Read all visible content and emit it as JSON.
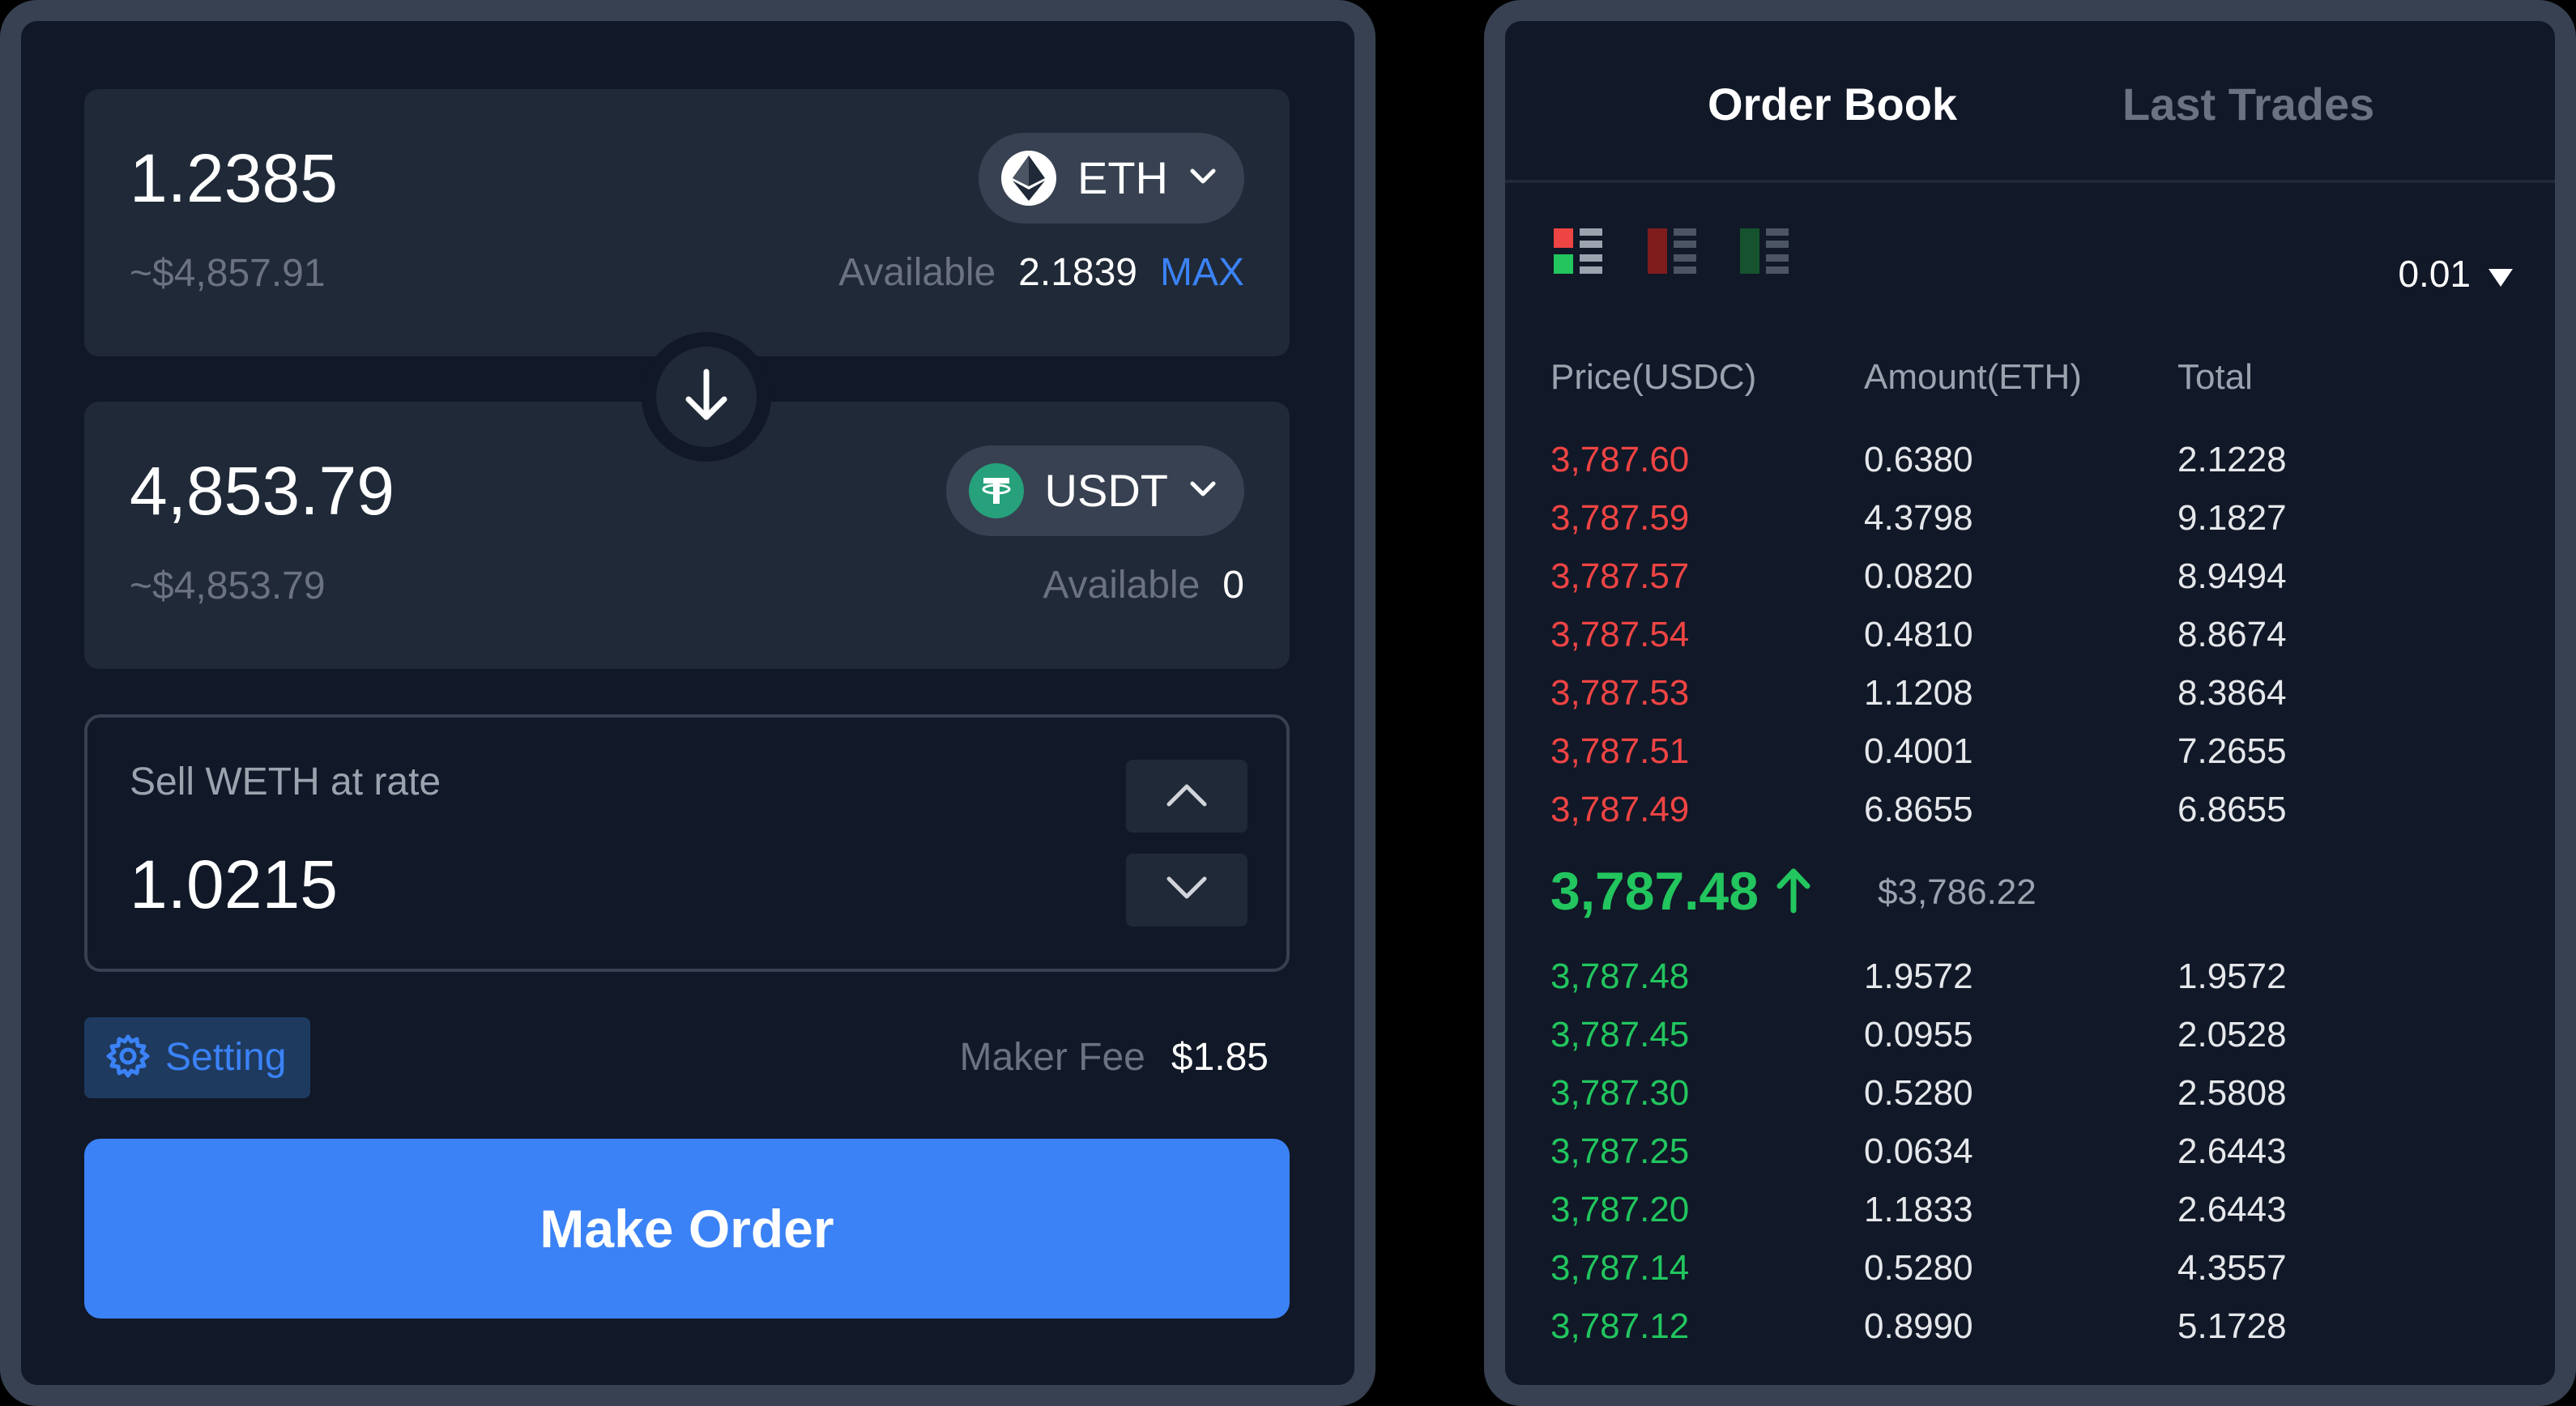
{
  "swap": {
    "from": {
      "amount": "1.2385",
      "usd": "~$4,857.91",
      "token": "ETH",
      "available_label": "Available",
      "available_value": "2.1839",
      "max_label": "MAX"
    },
    "to": {
      "amount": "4,853.79",
      "usd": "~$4,853.79",
      "token": "USDT",
      "available_label": "Available",
      "available_value": "0"
    },
    "rate": {
      "label": "Sell WETH at rate",
      "value": "1.0215"
    },
    "setting_label": "Setting",
    "fee_label": "Maker Fee",
    "fee_value": "$1.85",
    "submit_label": "Make Order"
  },
  "orderbook": {
    "tabs": [
      "Order Book",
      "Last Trades"
    ],
    "active_tab": "Order Book",
    "precision": "0.01",
    "columns": [
      "Price(USDC)",
      "Amount(ETH)",
      "Total"
    ],
    "asks": [
      {
        "price": "3,787.60",
        "amount": "0.6380",
        "total": "2.1228"
      },
      {
        "price": "3,787.59",
        "amount": "4.3798",
        "total": "9.1827"
      },
      {
        "price": "3,787.57",
        "amount": "0.0820",
        "total": "8.9494"
      },
      {
        "price": "3,787.54",
        "amount": "0.4810",
        "total": "8.8674"
      },
      {
        "price": "3,787.53",
        "amount": "1.1208",
        "total": "8.3864"
      },
      {
        "price": "3,787.51",
        "amount": "0.4001",
        "total": "7.2655"
      },
      {
        "price": "3,787.49",
        "amount": "6.8655",
        "total": "6.8655"
      }
    ],
    "mid_price": "3,787.48",
    "mid_usd": "$3,786.22",
    "bids": [
      {
        "price": "3,787.48",
        "amount": "1.9572",
        "total": "1.9572"
      },
      {
        "price": "3,787.45",
        "amount": "0.0955",
        "total": "2.0528"
      },
      {
        "price": "3,787.30",
        "amount": "0.5280",
        "total": "2.5808"
      },
      {
        "price": "3,787.25",
        "amount": "0.0634",
        "total": "2.6443"
      },
      {
        "price": "3,787.20",
        "amount": "1.1833",
        "total": "2.6443"
      },
      {
        "price": "3,787.14",
        "amount": "0.5280",
        "total": "4.3557"
      },
      {
        "price": "3,787.12",
        "amount": "0.8990",
        "total": "5.1728"
      }
    ]
  },
  "colors": {
    "accent": "#3b82f6",
    "ask": "#ef4444",
    "bid": "#22c55e",
    "panel": "#111827",
    "card": "#1f2937"
  },
  "icons": [
    "eth-icon",
    "usdt-icon",
    "chevron-down-icon",
    "arrow-down-icon",
    "chevron-up-icon",
    "gear-icon",
    "view-both-icon",
    "view-asks-icon",
    "view-bids-icon",
    "caret-down-icon",
    "arrow-up-icon"
  ]
}
